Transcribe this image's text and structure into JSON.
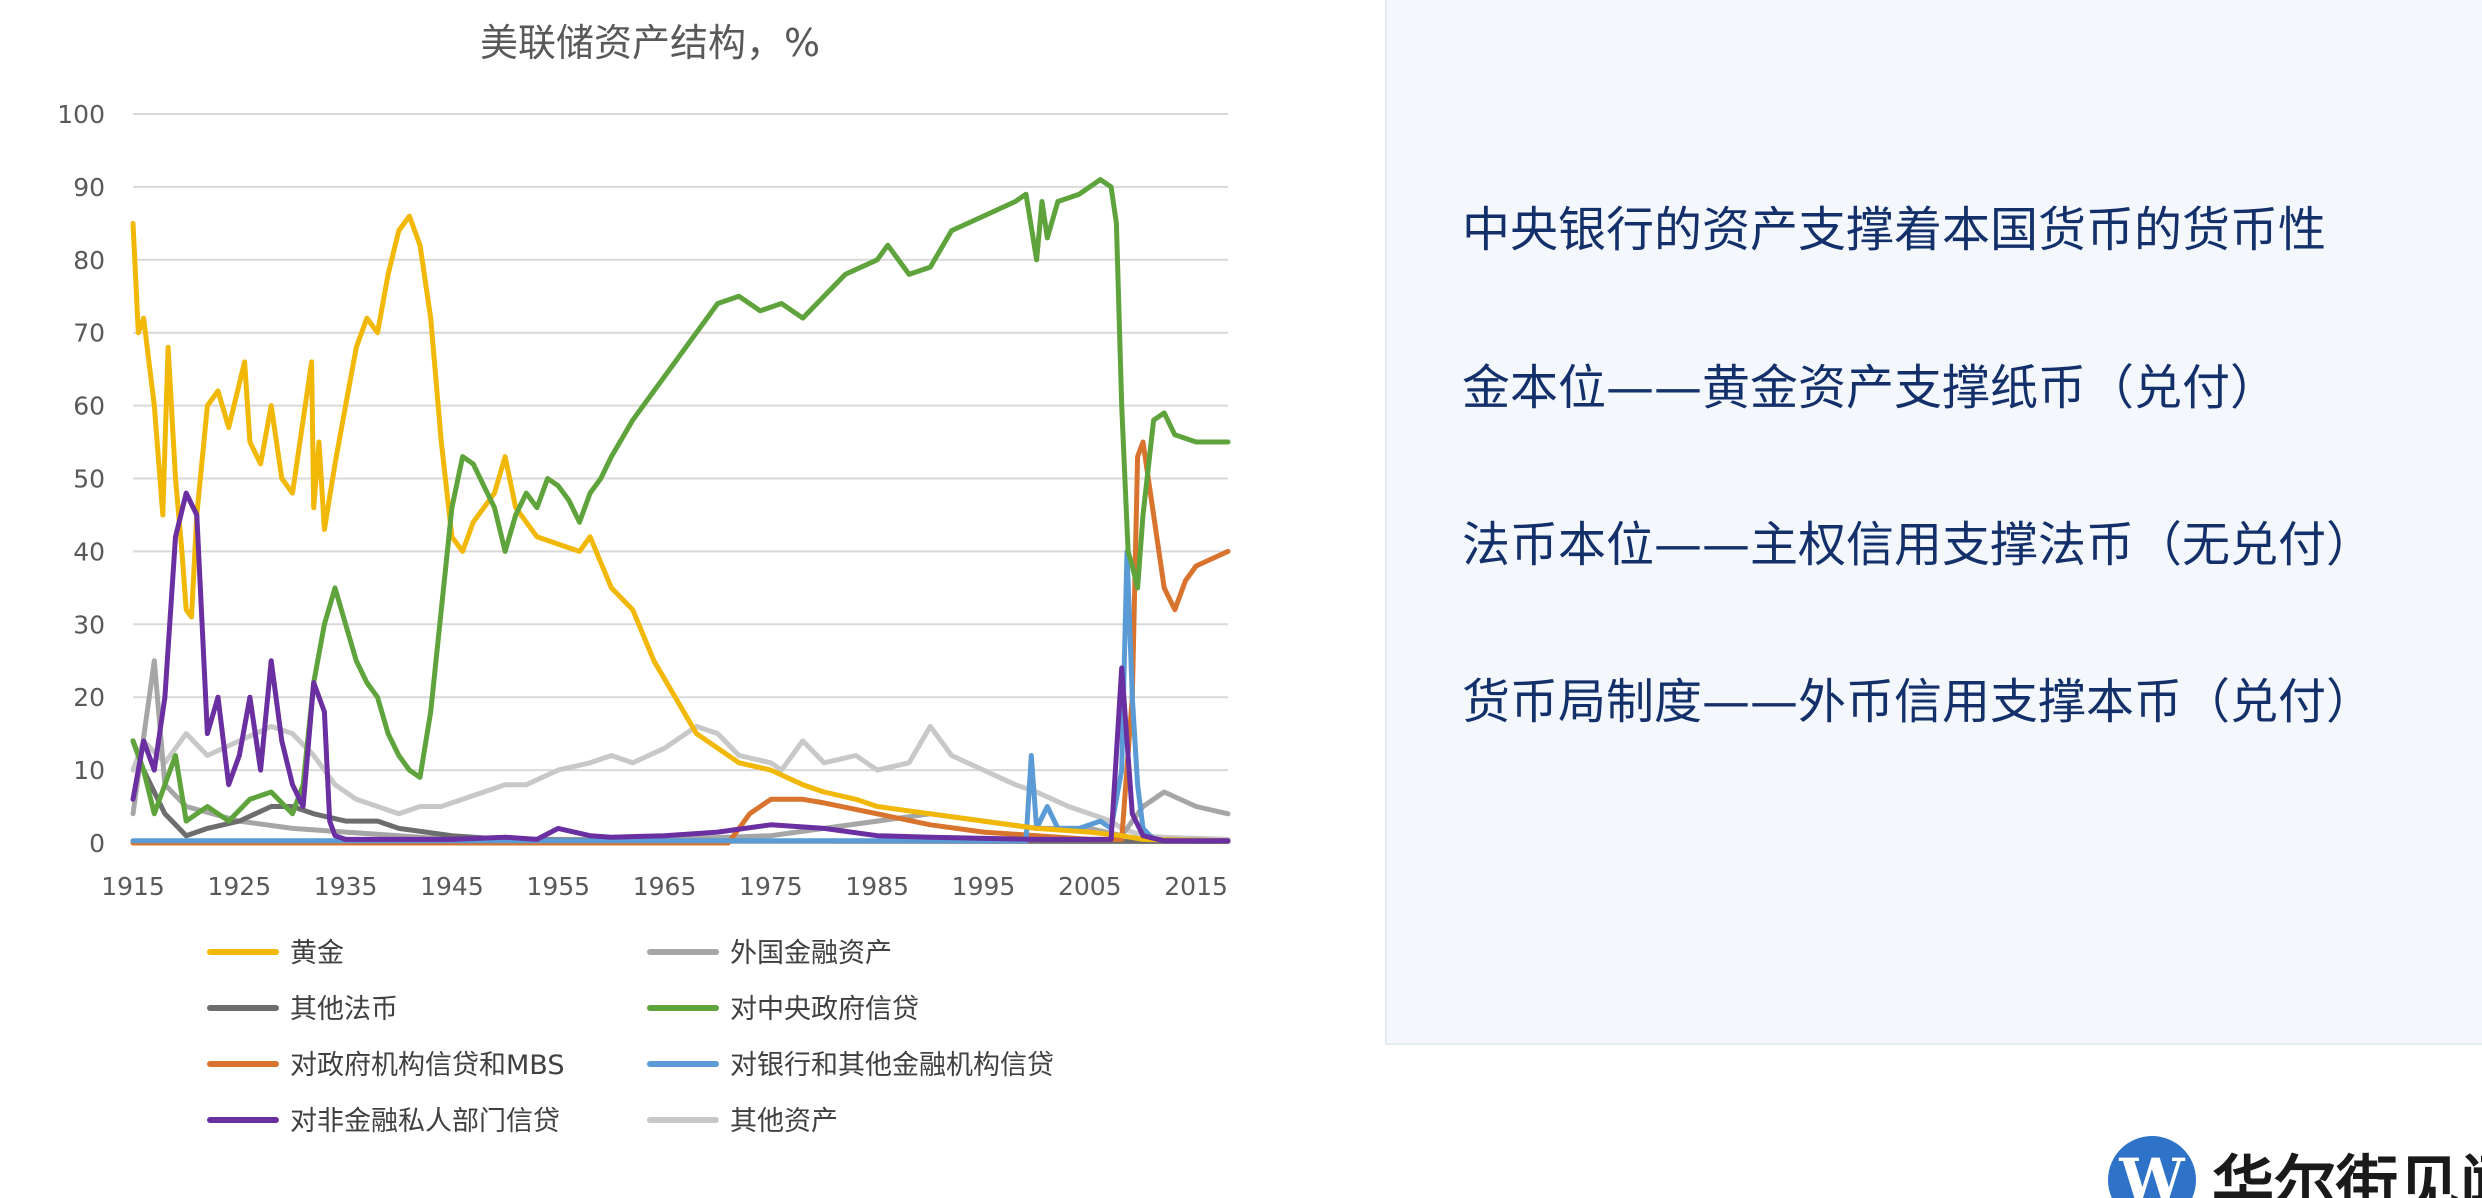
{
  "chart_data": {
    "type": "line",
    "title": "美联储资产结构，%",
    "xlabel": "",
    "ylabel": "",
    "xlim": [
      1915,
      2018
    ],
    "ylim": [
      0,
      100
    ],
    "xticks": [
      1915,
      1925,
      1935,
      1945,
      1955,
      1965,
      1975,
      1985,
      1995,
      2005,
      2015
    ],
    "yticks": [
      0,
      10,
      20,
      30,
      40,
      50,
      60,
      70,
      80,
      90,
      100
    ],
    "grid": true,
    "legend_position": "bottom",
    "series": [
      {
        "name": "黄金",
        "color": "#f2b807",
        "points": [
          [
            1915,
            85
          ],
          [
            1915.5,
            70
          ],
          [
            1916,
            72
          ],
          [
            1917,
            60
          ],
          [
            1917.8,
            45
          ],
          [
            1918.3,
            68
          ],
          [
            1919,
            50
          ],
          [
            1919.6,
            40
          ],
          [
            1920,
            32
          ],
          [
            1920.5,
            31
          ],
          [
            1921,
            45
          ],
          [
            1922,
            60
          ],
          [
            1923,
            62
          ],
          [
            1924,
            57
          ],
          [
            1925,
            63
          ],
          [
            1925.5,
            66
          ],
          [
            1926,
            55
          ],
          [
            1927,
            52
          ],
          [
            1928,
            60
          ],
          [
            1929,
            50
          ],
          [
            1930,
            48
          ],
          [
            1931,
            58
          ],
          [
            1931.8,
            66
          ],
          [
            1932,
            46
          ],
          [
            1932.5,
            55
          ],
          [
            1933,
            43
          ],
          [
            1934,
            52
          ],
          [
            1935,
            60
          ],
          [
            1936,
            68
          ],
          [
            1937,
            72
          ],
          [
            1938,
            70
          ],
          [
            1939,
            78
          ],
          [
            1940,
            84
          ],
          [
            1941,
            86
          ],
          [
            1942,
            82
          ],
          [
            1943,
            72
          ],
          [
            1944,
            55
          ],
          [
            1945,
            42
          ],
          [
            1946,
            40
          ],
          [
            1947,
            44
          ],
          [
            1948,
            46
          ],
          [
            1949,
            48
          ],
          [
            1950,
            53
          ],
          [
            1951,
            46
          ],
          [
            1952,
            44
          ],
          [
            1953,
            42
          ],
          [
            1955,
            41
          ],
          [
            1957,
            40
          ],
          [
            1958,
            42
          ],
          [
            1960,
            35
          ],
          [
            1962,
            32
          ],
          [
            1964,
            25
          ],
          [
            1966,
            20
          ],
          [
            1968,
            15
          ],
          [
            1970,
            13
          ],
          [
            1972,
            11
          ],
          [
            1975,
            10
          ],
          [
            1978,
            8
          ],
          [
            1980,
            7
          ],
          [
            1983,
            6
          ],
          [
            1985,
            5
          ],
          [
            1990,
            4
          ],
          [
            1995,
            3
          ],
          [
            2000,
            2
          ],
          [
            2005,
            1.5
          ],
          [
            2008,
            1
          ],
          [
            2010,
            0.5
          ],
          [
            2018,
            0.3
          ]
        ]
      },
      {
        "name": "外国金融资产",
        "color": "#a6a6a6",
        "points": [
          [
            1915,
            4
          ],
          [
            1917,
            25
          ],
          [
            1918,
            8
          ],
          [
            1920,
            5
          ],
          [
            1925,
            3
          ],
          [
            1930,
            2
          ],
          [
            1935,
            1.5
          ],
          [
            1940,
            1
          ],
          [
            1945,
            0.5
          ],
          [
            1965,
            0.5
          ],
          [
            1975,
            1
          ],
          [
            1980,
            2
          ],
          [
            1985,
            3
          ],
          [
            1990,
            4
          ],
          [
            1995,
            3
          ],
          [
            2000,
            2
          ],
          [
            2005,
            2
          ],
          [
            2008,
            1
          ],
          [
            2010,
            5
          ],
          [
            2012,
            7
          ],
          [
            2015,
            5
          ],
          [
            2018,
            4
          ]
        ]
      },
      {
        "name": "其他法币",
        "color": "#6d6d6d",
        "points": [
          [
            1915,
            14
          ],
          [
            1916,
            10
          ],
          [
            1918,
            4
          ],
          [
            1920,
            1
          ],
          [
            1922,
            2
          ],
          [
            1925,
            3
          ],
          [
            1928,
            5
          ],
          [
            1930,
            5
          ],
          [
            1932,
            4
          ],
          [
            1935,
            3
          ],
          [
            1938,
            3
          ],
          [
            1940,
            2
          ],
          [
            1945,
            1
          ],
          [
            1950,
            0.5
          ],
          [
            1960,
            0.3
          ],
          [
            2018,
            0.2
          ]
        ]
      },
      {
        "name": "对中央政府信贷",
        "color": "#5ea33b",
        "points": [
          [
            1915,
            14
          ],
          [
            1916,
            10
          ],
          [
            1917,
            4
          ],
          [
            1918,
            8
          ],
          [
            1919,
            12
          ],
          [
            1920,
            3
          ],
          [
            1922,
            5
          ],
          [
            1924,
            3
          ],
          [
            1926,
            6
          ],
          [
            1928,
            7
          ],
          [
            1930,
            4
          ],
          [
            1931,
            8
          ],
          [
            1932,
            22
          ],
          [
            1933,
            30
          ],
          [
            1934,
            35
          ],
          [
            1935,
            30
          ],
          [
            1936,
            25
          ],
          [
            1937,
            22
          ],
          [
            1938,
            20
          ],
          [
            1939,
            15
          ],
          [
            1940,
            12
          ],
          [
            1941,
            10
          ],
          [
            1942,
            9
          ],
          [
            1943,
            18
          ],
          [
            1944,
            32
          ],
          [
            1945,
            46
          ],
          [
            1946,
            53
          ],
          [
            1947,
            52
          ],
          [
            1948,
            49
          ],
          [
            1949,
            46
          ],
          [
            1950,
            40
          ],
          [
            1951,
            45
          ],
          [
            1952,
            48
          ],
          [
            1953,
            46
          ],
          [
            1954,
            50
          ],
          [
            1955,
            49
          ],
          [
            1956,
            47
          ],
          [
            1957,
            44
          ],
          [
            1958,
            48
          ],
          [
            1959,
            50
          ],
          [
            1960,
            53
          ],
          [
            1962,
            58
          ],
          [
            1964,
            62
          ],
          [
            1966,
            66
          ],
          [
            1968,
            70
          ],
          [
            1970,
            74
          ],
          [
            1972,
            75
          ],
          [
            1974,
            73
          ],
          [
            1976,
            74
          ],
          [
            1978,
            72
          ],
          [
            1980,
            75
          ],
          [
            1982,
            78
          ],
          [
            1985,
            80
          ],
          [
            1986,
            82
          ],
          [
            1988,
            78
          ],
          [
            1990,
            79
          ],
          [
            1992,
            84
          ],
          [
            1995,
            86
          ],
          [
            1998,
            88
          ],
          [
            1999,
            89
          ],
          [
            2000,
            80
          ],
          [
            2000.5,
            88
          ],
          [
            2001,
            83
          ],
          [
            2002,
            88
          ],
          [
            2004,
            89
          ],
          [
            2006,
            91
          ],
          [
            2007,
            90
          ],
          [
            2007.5,
            85
          ],
          [
            2008,
            60
          ],
          [
            2008.6,
            40
          ],
          [
            2009,
            38
          ],
          [
            2009.5,
            35
          ],
          [
            2010,
            45
          ],
          [
            2011,
            58
          ],
          [
            2012,
            59
          ],
          [
            2013,
            56
          ],
          [
            2015,
            55
          ],
          [
            2018,
            55
          ]
        ]
      },
      {
        "name": "对政府机构信贷和MBS",
        "color": "#d9742f",
        "points": [
          [
            1915,
            0
          ],
          [
            1971,
            0
          ],
          [
            1972,
            2
          ],
          [
            1973,
            4
          ],
          [
            1974,
            5
          ],
          [
            1975,
            6
          ],
          [
            1978,
            6
          ],
          [
            1980,
            5.5
          ],
          [
            1985,
            4
          ],
          [
            1990,
            2.5
          ],
          [
            1995,
            1.5
          ],
          [
            2000,
            1
          ],
          [
            2005,
            0.5
          ],
          [
            2008,
            0.5
          ],
          [
            2009,
            20
          ],
          [
            2009.5,
            53
          ],
          [
            2010,
            55
          ],
          [
            2011,
            45
          ],
          [
            2012,
            35
          ],
          [
            2013,
            32
          ],
          [
            2014,
            36
          ],
          [
            2015,
            38
          ],
          [
            2018,
            40
          ]
        ]
      },
      {
        "name": "对银行和其他金融机构信贷",
        "color": "#5b9bd5",
        "points": [
          [
            1915,
            0.3
          ],
          [
            1999,
            0.3
          ],
          [
            1999.5,
            12
          ],
          [
            2000,
            2
          ],
          [
            2001,
            5
          ],
          [
            2002,
            2
          ],
          [
            2004,
            2
          ],
          [
            2006,
            3
          ],
          [
            2007,
            2
          ],
          [
            2008,
            10
          ],
          [
            2008.5,
            40
          ],
          [
            2009,
            20
          ],
          [
            2009.5,
            8
          ],
          [
            2010,
            2
          ],
          [
            2011,
            0.5
          ],
          [
            2018,
            0.3
          ]
        ]
      },
      {
        "name": "对非金融私人部门信贷",
        "color": "#6a2fa0",
        "points": [
          [
            1915,
            6
          ],
          [
            1916,
            14
          ],
          [
            1917,
            10
          ],
          [
            1918,
            20
          ],
          [
            1919,
            42
          ],
          [
            1920,
            48
          ],
          [
            1921,
            45
          ],
          [
            1922,
            15
          ],
          [
            1923,
            20
          ],
          [
            1924,
            8
          ],
          [
            1925,
            12
          ],
          [
            1926,
            20
          ],
          [
            1927,
            10
          ],
          [
            1928,
            25
          ],
          [
            1929,
            14
          ],
          [
            1930,
            8
          ],
          [
            1931,
            5
          ],
          [
            1932,
            22
          ],
          [
            1933,
            18
          ],
          [
            1933.5,
            3
          ],
          [
            1934,
            1
          ],
          [
            1935,
            0.5
          ],
          [
            1945,
            0.5
          ],
          [
            1950,
            0.8
          ],
          [
            1953,
            0.5
          ],
          [
            1955,
            2
          ],
          [
            1958,
            1
          ],
          [
            1960,
            0.8
          ],
          [
            1965,
            1
          ],
          [
            1970,
            1.5
          ],
          [
            1975,
            2.5
          ],
          [
            1980,
            2
          ],
          [
            1985,
            1
          ],
          [
            1990,
            0.8
          ],
          [
            2000,
            0.5
          ],
          [
            2007,
            0.5
          ],
          [
            2008,
            24
          ],
          [
            2009,
            4
          ],
          [
            2010,
            1
          ],
          [
            2012,
            0.3
          ],
          [
            2018,
            0.3
          ]
        ]
      },
      {
        "name": "其他资产",
        "color": "#c8c8c8",
        "points": [
          [
            1915,
            10
          ],
          [
            1916,
            14
          ],
          [
            1918,
            11
          ],
          [
            1920,
            15
          ],
          [
            1922,
            12
          ],
          [
            1925,
            14
          ],
          [
            1928,
            16
          ],
          [
            1930,
            15
          ],
          [
            1932,
            12
          ],
          [
            1934,
            8
          ],
          [
            1936,
            6
          ],
          [
            1938,
            5
          ],
          [
            1940,
            4
          ],
          [
            1942,
            5
          ],
          [
            1944,
            5
          ],
          [
            1946,
            6
          ],
          [
            1948,
            7
          ],
          [
            1950,
            8
          ],
          [
            1952,
            8
          ],
          [
            1955,
            10
          ],
          [
            1958,
            11
          ],
          [
            1960,
            12
          ],
          [
            1962,
            11
          ],
          [
            1965,
            13
          ],
          [
            1968,
            16
          ],
          [
            1970,
            15
          ],
          [
            1972,
            12
          ],
          [
            1975,
            11
          ],
          [
            1976,
            10
          ],
          [
            1978,
            14
          ],
          [
            1980,
            11
          ],
          [
            1983,
            12
          ],
          [
            1985,
            10
          ],
          [
            1988,
            11
          ],
          [
            1990,
            16
          ],
          [
            1992,
            12
          ],
          [
            1995,
            10
          ],
          [
            1998,
            8
          ],
          [
            2000,
            7
          ],
          [
            2003,
            5
          ],
          [
            2005,
            4
          ],
          [
            2007,
            3
          ],
          [
            2008,
            2
          ],
          [
            2010,
            1
          ],
          [
            2012,
            0.8
          ],
          [
            2018,
            0.5
          ]
        ]
      }
    ]
  },
  "side_panel": {
    "bullets": [
      "中央银行的资产支撑着本国货币的货币性",
      "金本位——黄金资产支撑纸币（兑付）",
      "法币本位——主权信用支撑法币（无兑付）",
      "货币局制度——外币信用支撑本币（兑付）"
    ]
  },
  "brand": {
    "logo_letter": "W",
    "text": "华尔街见闻"
  }
}
